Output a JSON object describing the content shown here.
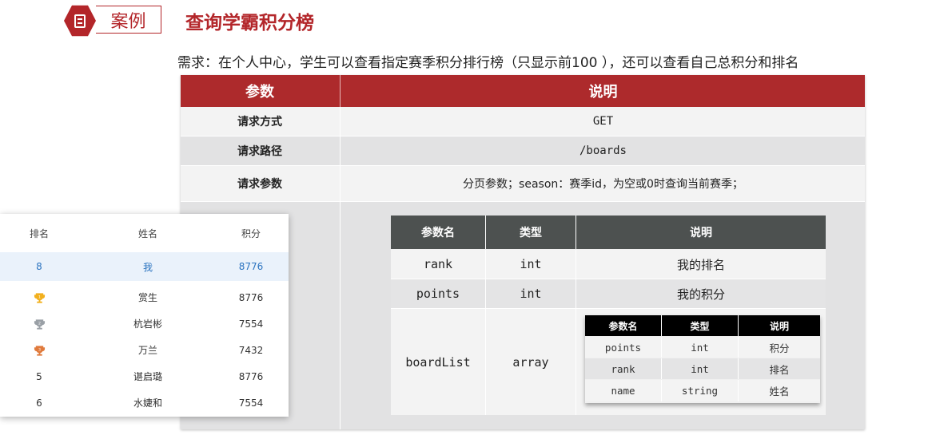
{
  "header": {
    "badge_label": "案例",
    "title": "查询学霸积分榜"
  },
  "requirement": "需求：在个人中心，学生可以查看指定赛季积分排行榜（只显示前100 ），还可以查看自己总积分和排名",
  "main_table": {
    "headers": [
      "参数",
      "说明"
    ],
    "rows": [
      {
        "key": "请求方式",
        "value": "GET"
      },
      {
        "key": "请求路径",
        "value": "/boards"
      },
      {
        "key": "请求参数",
        "value": "分页参数；season：赛季id，为空或0时查询当前赛季；"
      }
    ]
  },
  "response_table": {
    "headers": [
      "参数名",
      "类型",
      "说明"
    ],
    "rows": [
      {
        "name": "rank",
        "type": "int",
        "desc": "我的排名"
      },
      {
        "name": "points",
        "type": "int",
        "desc": "我的积分"
      },
      {
        "name": "boardList",
        "type": "array"
      }
    ]
  },
  "board_list_table": {
    "headers": [
      "参数名",
      "类型",
      "说明"
    ],
    "rows": [
      {
        "name": "points",
        "type": "int",
        "desc": "积分"
      },
      {
        "name": "rank",
        "type": "int",
        "desc": "排名"
      },
      {
        "name": "name",
        "type": "string",
        "desc": "姓名"
      }
    ]
  },
  "leaderboard": {
    "headers": [
      "排名",
      "姓名",
      "积分"
    ],
    "me": {
      "rank": "8",
      "name": "我",
      "points": "8776"
    },
    "rows": [
      {
        "rank_icon": "gold-trophy-icon",
        "name": "赏生",
        "points": "8776"
      },
      {
        "rank_icon": "silver-trophy-icon",
        "name": "杭岩彬",
        "points": "7554"
      },
      {
        "rank_icon": "bronze-trophy-icon",
        "name": "万兰",
        "points": "7432"
      },
      {
        "rank": "5",
        "name": "谌启璐",
        "points": "8776"
      },
      {
        "rank": "6",
        "name": "水婕和",
        "points": "7554"
      }
    ],
    "colors": {
      "me_bg": "#eaf2fb",
      "me_text": "#2c74c0"
    }
  },
  "colors": {
    "accent": "#b3262a",
    "main_header": "#ad2a2c",
    "nested_header": "#4d5150",
    "inner_header": "#000000"
  }
}
